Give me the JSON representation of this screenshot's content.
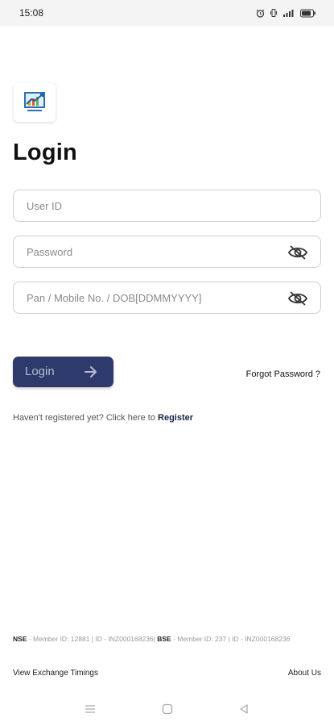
{
  "status_bar": {
    "time": "15:08",
    "icons": [
      "alarm-icon",
      "vibrate-icon",
      "signal-icon",
      "battery-icon"
    ]
  },
  "brand": {
    "logo_icon": "chart-logo-icon",
    "accent_color": "#2d3a6b"
  },
  "login_form": {
    "title": "Login",
    "user_id_placeholder": "User ID",
    "password_placeholder": "Password",
    "pan_placeholder": "Pan / Mobile No. / DOB[DDMMYYYY]",
    "login_button_label": "Login",
    "forgot_password_label": "Forgot Password ?"
  },
  "register": {
    "prompt": "Haven't registered yet? Click here to ",
    "link_label": "Register"
  },
  "footer": {
    "nse_label": "NSE",
    "nse_text": " - Member ID: 12881 | ID - INZ000168236| ",
    "bse_label": "BSE",
    "bse_text": " - Member ID: 237 | ID - INZ000168236",
    "view_timings_label": "View Exchange Timings",
    "about_label": "About Us"
  },
  "nav_bar": {
    "icons": [
      "menu-icon",
      "home-icon",
      "back-icon"
    ]
  }
}
